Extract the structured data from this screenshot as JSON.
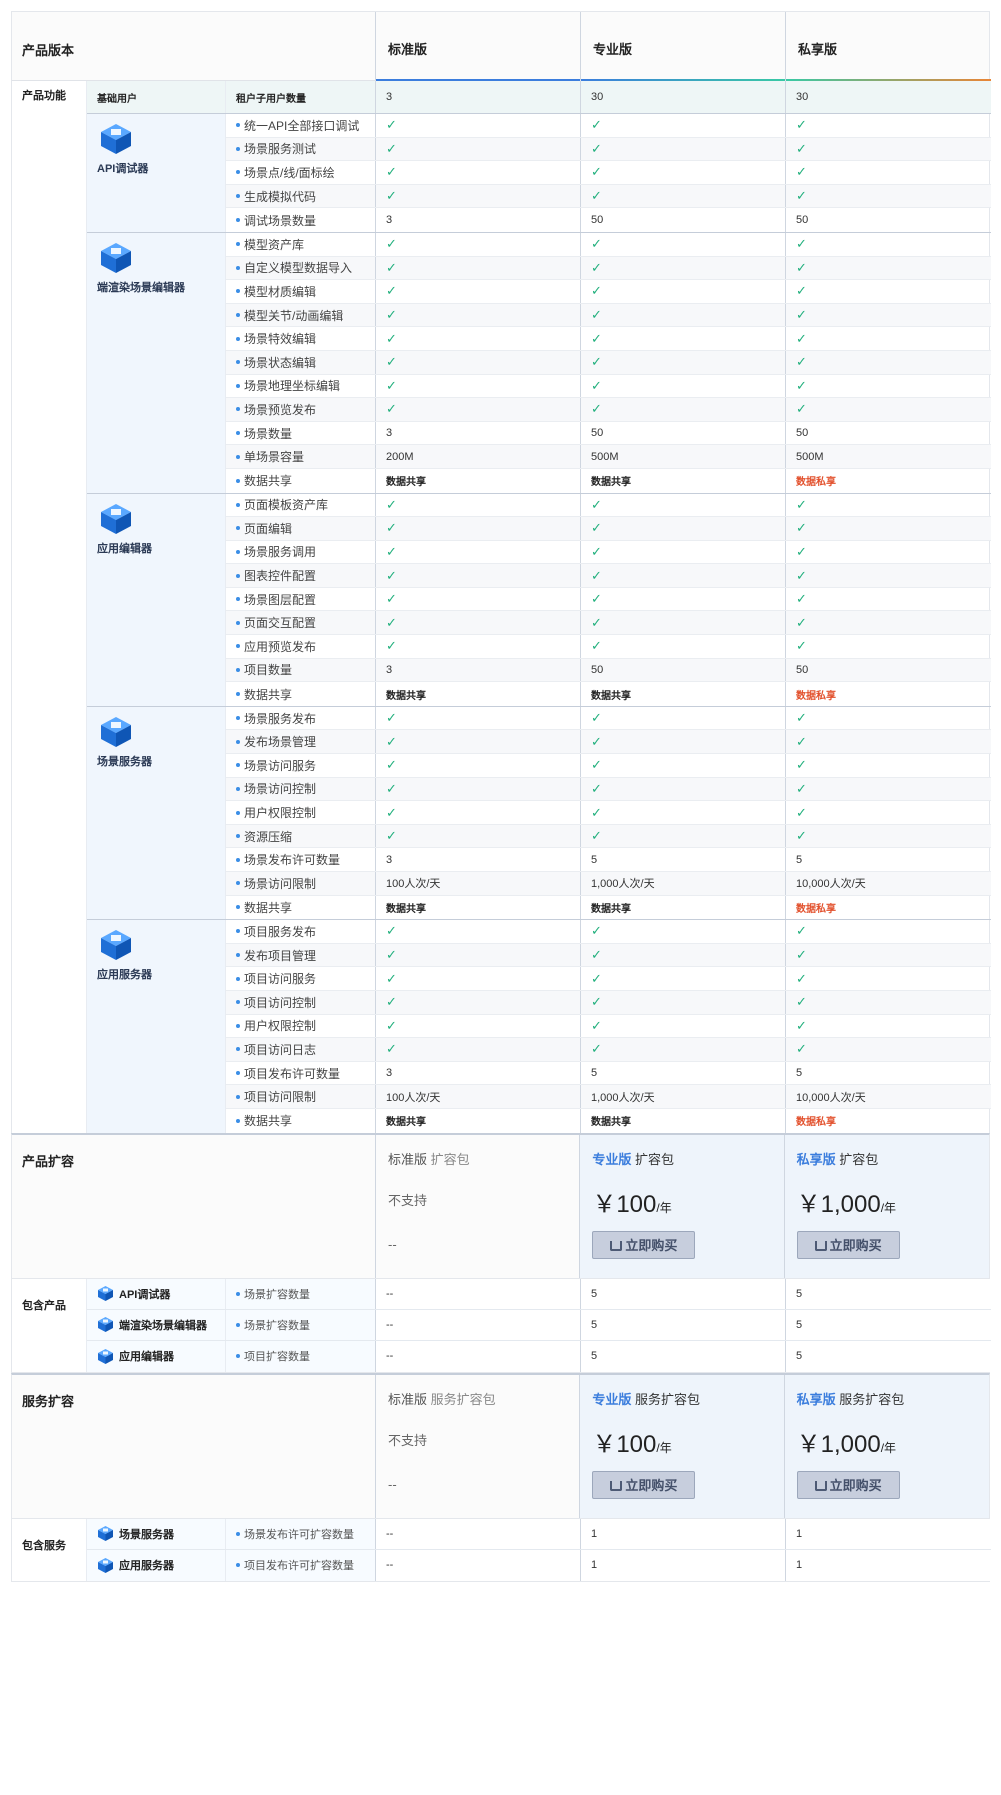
{
  "header": {
    "label": "产品版本",
    "versions": [
      "标准版",
      "专业版",
      "私享版"
    ]
  },
  "features": {
    "label": "产品功能",
    "base": {
      "group": "基础用户",
      "item": "租户子用户数量",
      "values": [
        "3",
        "30",
        "30"
      ]
    },
    "groups": [
      {
        "name": "API调试器",
        "icon": "api-debugger-icon",
        "rows": [
          {
            "item": "统一API全部接口调试",
            "values": [
              "✓",
              "✓",
              "✓"
            ]
          },
          {
            "item": "场景服务测试",
            "values": [
              "✓",
              "✓",
              "✓"
            ]
          },
          {
            "item": "场景点/线/面标绘",
            "values": [
              "✓",
              "✓",
              "✓"
            ]
          },
          {
            "item": "生成模拟代码",
            "values": [
              "✓",
              "✓",
              "✓"
            ]
          },
          {
            "item": "调试场景数量",
            "values": [
              "3",
              "50",
              "50"
            ]
          }
        ]
      },
      {
        "name": "端渲染场景编辑器",
        "icon": "scene-editor-icon",
        "rows": [
          {
            "item": "模型资产库",
            "values": [
              "✓",
              "✓",
              "✓"
            ]
          },
          {
            "item": "自定义模型数据导入",
            "values": [
              "✓",
              "✓",
              "✓"
            ]
          },
          {
            "item": "模型材质编辑",
            "values": [
              "✓",
              "✓",
              "✓"
            ]
          },
          {
            "item": "模型关节/动画编辑",
            "values": [
              "✓",
              "✓",
              "✓"
            ]
          },
          {
            "item": "场景特效编辑",
            "values": [
              "✓",
              "✓",
              "✓"
            ]
          },
          {
            "item": "场景状态编辑",
            "values": [
              "✓",
              "✓",
              "✓"
            ]
          },
          {
            "item": "场景地理坐标编辑",
            "values": [
              "✓",
              "✓",
              "✓"
            ]
          },
          {
            "item": "场景预览发布",
            "values": [
              "✓",
              "✓",
              "✓"
            ]
          },
          {
            "item": "场景数量",
            "values": [
              "3",
              "50",
              "50"
            ]
          },
          {
            "item": "单场景容量",
            "values": [
              "200M",
              "500M",
              "500M"
            ]
          },
          {
            "item": "数据共享",
            "values": [
              "数据共享",
              "数据共享",
              "数据私享"
            ]
          }
        ]
      },
      {
        "name": "应用编辑器",
        "icon": "app-editor-icon",
        "rows": [
          {
            "item": "页面模板资产库",
            "values": [
              "✓",
              "✓",
              "✓"
            ]
          },
          {
            "item": "页面编辑",
            "values": [
              "✓",
              "✓",
              "✓"
            ]
          },
          {
            "item": "场景服务调用",
            "values": [
              "✓",
              "✓",
              "✓"
            ]
          },
          {
            "item": "图表控件配置",
            "values": [
              "✓",
              "✓",
              "✓"
            ]
          },
          {
            "item": "场景图层配置",
            "values": [
              "✓",
              "✓",
              "✓"
            ]
          },
          {
            "item": "页面交互配置",
            "values": [
              "✓",
              "✓",
              "✓"
            ]
          },
          {
            "item": "应用预览发布",
            "values": [
              "✓",
              "✓",
              "✓"
            ]
          },
          {
            "item": "项目数量",
            "values": [
              "3",
              "50",
              "50"
            ]
          },
          {
            "item": "数据共享",
            "values": [
              "数据共享",
              "数据共享",
              "数据私享"
            ]
          }
        ]
      },
      {
        "name": "场景服务器",
        "icon": "scene-server-icon",
        "rows": [
          {
            "item": "场景服务发布",
            "values": [
              "✓",
              "✓",
              "✓"
            ]
          },
          {
            "item": "发布场景管理",
            "values": [
              "✓",
              "✓",
              "✓"
            ]
          },
          {
            "item": "场景访问服务",
            "values": [
              "✓",
              "✓",
              "✓"
            ]
          },
          {
            "item": "场景访问控制",
            "values": [
              "✓",
              "✓",
              "✓"
            ]
          },
          {
            "item": "用户权限控制",
            "values": [
              "✓",
              "✓",
              "✓"
            ]
          },
          {
            "item": "资源压缩",
            "values": [
              "✓",
              "✓",
              "✓"
            ]
          },
          {
            "item": "场景发布许可数量",
            "values": [
              "3",
              "5",
              "5"
            ]
          },
          {
            "item": "场景访问限制",
            "values": [
              "100人次/天",
              "1,000人次/天",
              "10,000人次/天"
            ]
          },
          {
            "item": "数据共享",
            "values": [
              "数据共享",
              "数据共享",
              "数据私享"
            ]
          }
        ]
      },
      {
        "name": "应用服务器",
        "icon": "app-server-icon",
        "rows": [
          {
            "item": "项目服务发布",
            "values": [
              "✓",
              "✓",
              "✓"
            ]
          },
          {
            "item": "发布项目管理",
            "values": [
              "✓",
              "✓",
              "✓"
            ]
          },
          {
            "item": "项目访问服务",
            "values": [
              "✓",
              "✓",
              "✓"
            ]
          },
          {
            "item": "项目访问控制",
            "values": [
              "✓",
              "✓",
              "✓"
            ]
          },
          {
            "item": "用户权限控制",
            "values": [
              "✓",
              "✓",
              "✓"
            ]
          },
          {
            "item": "项目访问日志",
            "values": [
              "✓",
              "✓",
              "✓"
            ]
          },
          {
            "item": "项目发布许可数量",
            "values": [
              "3",
              "5",
              "5"
            ]
          },
          {
            "item": "项目访问限制",
            "values": [
              "100人次/天",
              "1,000人次/天",
              "10,000人次/天"
            ]
          },
          {
            "item": "数据共享",
            "values": [
              "数据共享",
              "数据共享",
              "数据私享"
            ]
          }
        ]
      }
    ]
  },
  "product_ext": {
    "label": "产品扩容",
    "std": {
      "name": "标准版",
      "suffix": "扩容包",
      "unsupported": "不支持",
      "dash": "--"
    },
    "pro": {
      "name": "专业版",
      "suffix": "扩容包",
      "price": "￥100",
      "unit": "/年",
      "buy": "立即购买"
    },
    "pri": {
      "name": "私享版",
      "suffix": "扩容包",
      "price": "￥1,000",
      "unit": "/年",
      "buy": "立即购买"
    },
    "include_label": "包含产品",
    "rows": [
      {
        "name": "API调试器",
        "item": "场景扩容数量",
        "values": [
          "--",
          "5",
          "5"
        ]
      },
      {
        "name": "端渲染场景编辑器",
        "item": "场景扩容数量",
        "values": [
          "--",
          "5",
          "5"
        ]
      },
      {
        "name": "应用编辑器",
        "item": "项目扩容数量",
        "values": [
          "--",
          "5",
          "5"
        ]
      }
    ]
  },
  "service_ext": {
    "label": "服务扩容",
    "std": {
      "name": "标准版",
      "suffix": "服务扩容包",
      "unsupported": "不支持",
      "dash": "--"
    },
    "pro": {
      "name": "专业版",
      "suffix": "服务扩容包",
      "price": "￥100",
      "unit": "/年",
      "buy": "立即购买"
    },
    "pri": {
      "name": "私享版",
      "suffix": "服务扩容包",
      "price": "￥1,000",
      "unit": "/年",
      "buy": "立即购买"
    },
    "include_label": "包含服务",
    "rows": [
      {
        "name": "场景服务器",
        "item": "场景发布许可扩容数量",
        "values": [
          "--",
          "1",
          "1"
        ]
      },
      {
        "name": "应用服务器",
        "item": "项目发布许可扩容数量",
        "values": [
          "--",
          "1",
          "1"
        ]
      }
    ]
  },
  "colors": {
    "accent": "#3b7ddd",
    "check": "#22b07d",
    "private": "#e2502c"
  }
}
